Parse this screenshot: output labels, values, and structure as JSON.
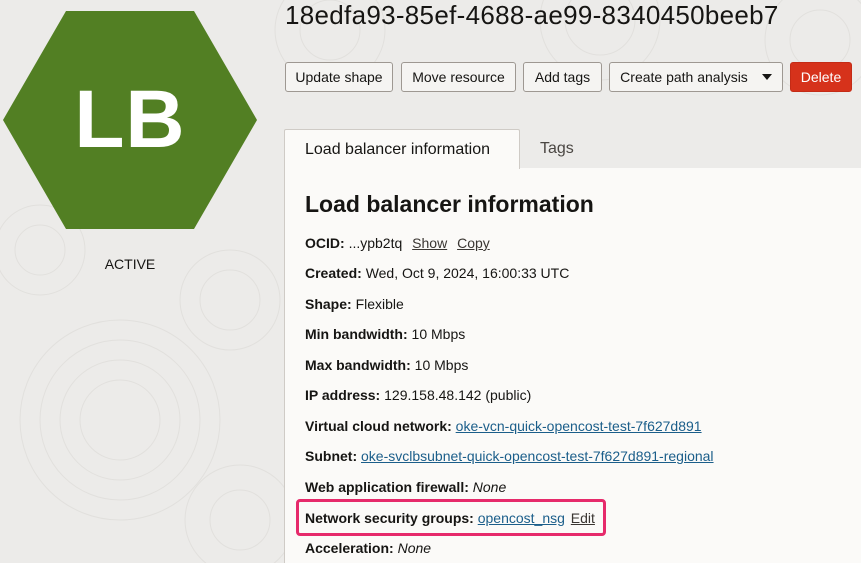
{
  "badge": {
    "initials": "LB",
    "color": "#527f23"
  },
  "status": "ACTIVE",
  "title": "18edfa93-85ef-4688-ae99-8340450beeb7",
  "toolbar": {
    "update_shape": "Update shape",
    "move_resource": "Move resource",
    "add_tags": "Add tags",
    "create_path_analysis": "Create path analysis",
    "delete": "Delete"
  },
  "tabs": [
    {
      "label": "Load balancer information",
      "active": true
    },
    {
      "label": "Tags",
      "active": false
    }
  ],
  "info": {
    "heading": "Load balancer information",
    "ocid_label": "OCID:",
    "ocid_value": "...ypb2tq",
    "ocid_show": "Show",
    "ocid_copy": "Copy",
    "created_label": "Created:",
    "created_value": "Wed, Oct 9, 2024, 16:00:33 UTC",
    "shape_label": "Shape:",
    "shape_value": "Flexible",
    "min_bw_label": "Min bandwidth:",
    "min_bw_value": "10 Mbps",
    "max_bw_label": "Max bandwidth:",
    "max_bw_value": "10 Mbps",
    "ip_label": "IP address:",
    "ip_value": "129.158.48.142 (public)",
    "vcn_label": "Virtual cloud network:",
    "vcn_value": "oke-vcn-quick-opencost-test-7f627d891",
    "subnet_label": "Subnet:",
    "subnet_value": "oke-svclbsubnet-quick-opencost-test-7f627d891-regional",
    "waf_label": "Web application firewall:",
    "waf_value": "None",
    "nsg_label": "Network security groups:",
    "nsg_value": "opencost_nsg",
    "nsg_edit": "Edit",
    "accel_label": "Acceleration:",
    "accel_value": "None"
  },
  "colors": {
    "highlight": "#e62a6b",
    "delete": "#d6321b",
    "link": "#1b5e8a"
  }
}
